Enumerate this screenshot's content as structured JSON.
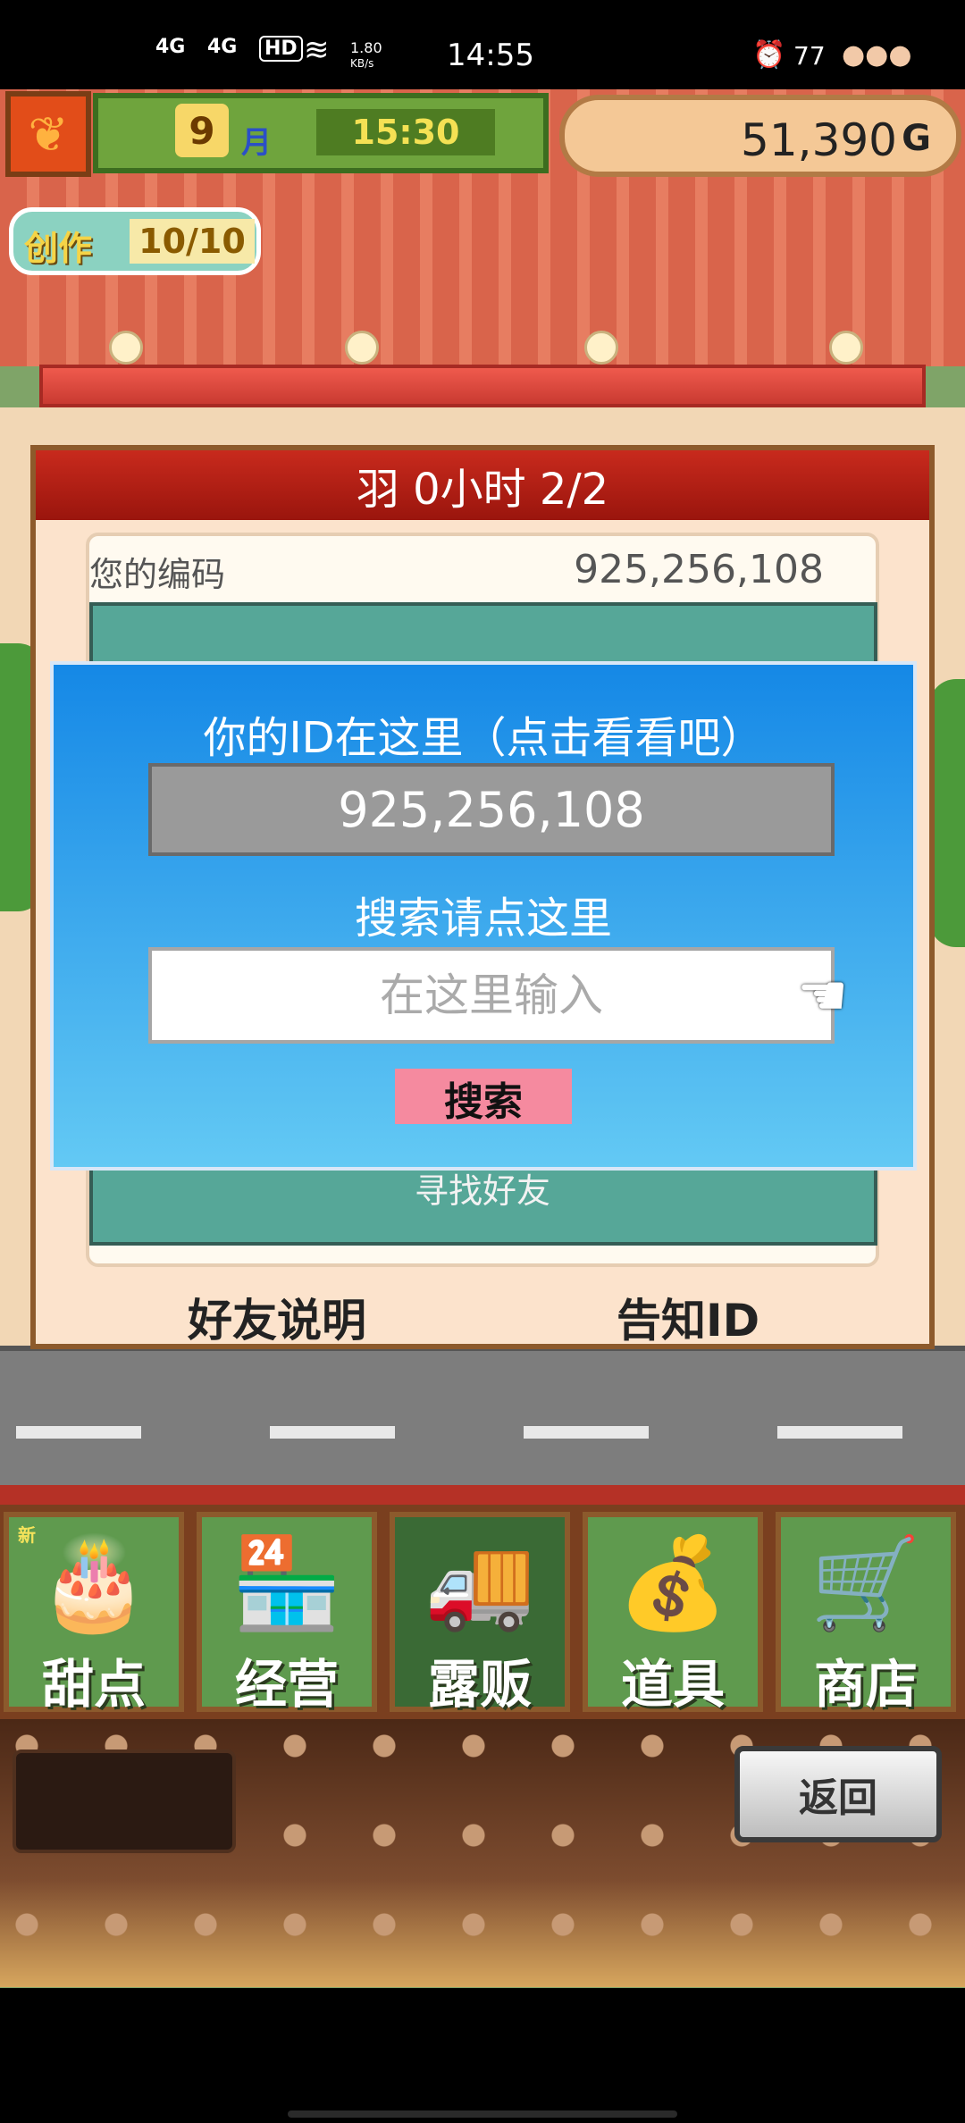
{
  "status_bar": {
    "signal1": "4G",
    "signal2": "4G",
    "hd": "HD",
    "net_speed": "1.80",
    "net_unit": "KB/s",
    "time": "14:55",
    "battery": "77"
  },
  "hud": {
    "month_number": "9",
    "month_label": "月",
    "game_time": "15:30",
    "money": "51,390",
    "money_unit": "G",
    "create_label": "创作",
    "create_count": "10/10"
  },
  "panel": {
    "header": "羽 0小时 2/2",
    "code_label": "您的编码",
    "code_value": "925,256,108",
    "find_friend": "寻找好友",
    "friend_help": "好友说明",
    "notify_id": "告知ID"
  },
  "modal": {
    "title": "你的ID在这里（点击看看吧）",
    "id_value": "925,256,108",
    "search_hint": "搜索请点这里",
    "search_placeholder": "在这里输入",
    "search_button": "搜索"
  },
  "menu": {
    "new_badge": "新",
    "items": [
      {
        "label": "甜点",
        "icon": "cake-icon"
      },
      {
        "label": "经营",
        "icon": "shop-icon"
      },
      {
        "label": "露贩",
        "icon": "food-truck-icon"
      },
      {
        "label": "道具",
        "icon": "items-bag-icon"
      },
      {
        "label": "商店",
        "icon": "shopping-cart-icon"
      }
    ]
  },
  "footer": {
    "back_button": "返回"
  }
}
